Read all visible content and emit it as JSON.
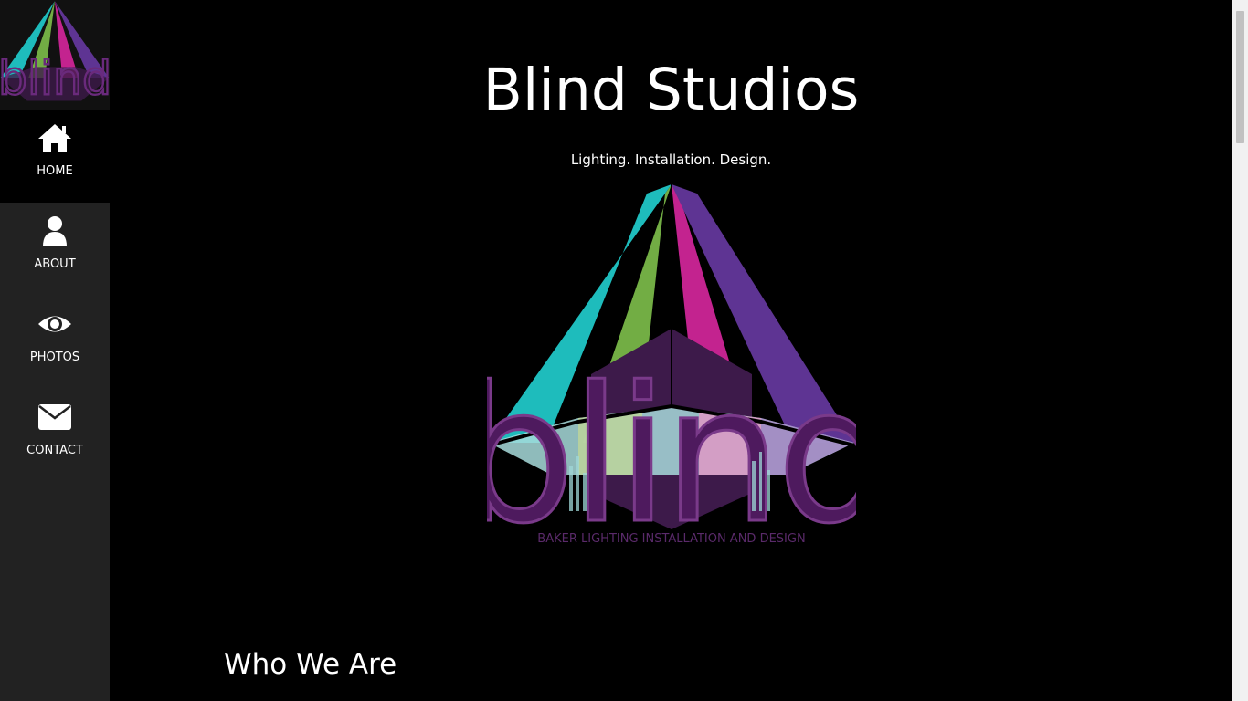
{
  "sidebar": {
    "logo_text": "blind",
    "items": [
      {
        "label": "HOME",
        "icon": "home-icon",
        "active": true
      },
      {
        "label": "ABOUT",
        "icon": "user-icon",
        "active": false
      },
      {
        "label": "PHOTOS",
        "icon": "eye-icon",
        "active": false
      },
      {
        "label": "CONTACT",
        "icon": "envelope-icon",
        "active": false
      }
    ]
  },
  "main": {
    "title": "Blind Studios",
    "tagline": "Lighting. Installation. Design.",
    "logo": {
      "wordmark": "blind",
      "subtitle": "BAKER LIGHTING INSTALLATION AND DESIGN"
    },
    "section_heading": "Who We Are"
  },
  "colors": {
    "background": "#000000",
    "sidebar": "#222222",
    "beam_teal": "#1ebcbc",
    "beam_green": "#72ad44",
    "beam_magenta": "#c3238f",
    "beam_purple": "#5e3493",
    "wordmark": "#4e1a5e"
  }
}
